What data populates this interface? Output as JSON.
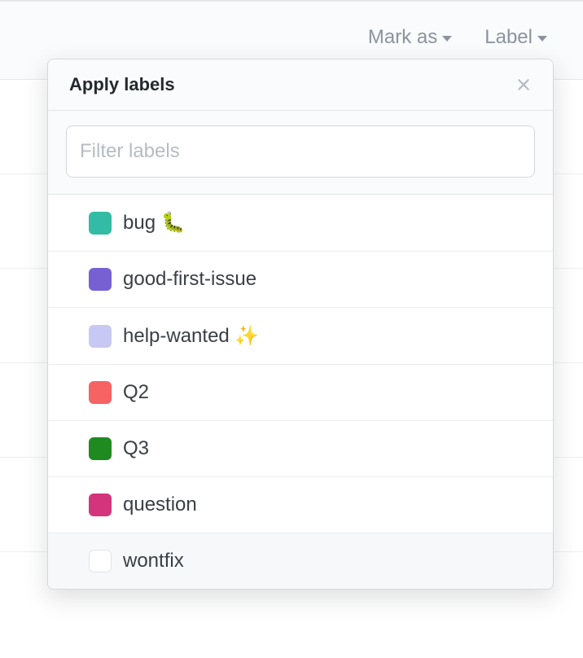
{
  "toolbar": {
    "mark_as_label": "Mark as",
    "label_label": "Label"
  },
  "dropdown": {
    "title": "Apply labels",
    "filter_placeholder": "Filter labels"
  },
  "labels": [
    {
      "name": "bug 🐛",
      "color": "#32bca5"
    },
    {
      "name": "good-first-issue",
      "color": "#7660d4"
    },
    {
      "name": "help-wanted ✨",
      "color": "#c7c8f4"
    },
    {
      "name": "Q2",
      "color": "#f76262"
    },
    {
      "name": "Q3",
      "color": "#1f8a1f"
    },
    {
      "name": "question",
      "color": "#d4347c"
    },
    {
      "name": "wontfix",
      "color": "#ffffff"
    }
  ]
}
